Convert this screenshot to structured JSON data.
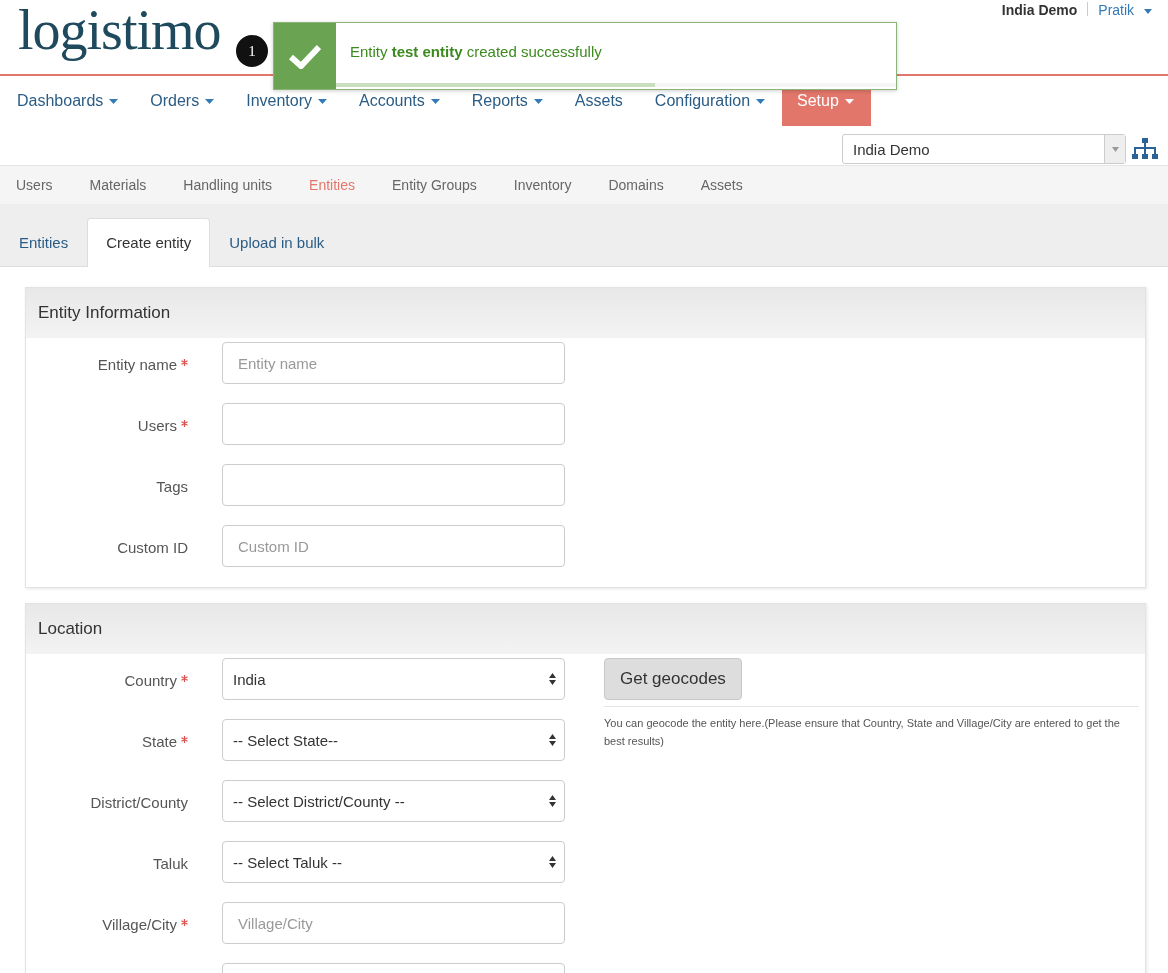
{
  "logo": {
    "text": "logistimo"
  },
  "user_bar": {
    "domain": "India Demo",
    "user": "Pratik"
  },
  "main_nav": [
    {
      "label": "Dashboards",
      "selected": false
    },
    {
      "label": "Orders",
      "selected": false
    },
    {
      "label": "Inventory",
      "selected": false
    },
    {
      "label": "Accounts",
      "selected": false
    },
    {
      "label": "Reports",
      "selected": false
    },
    {
      "label": "Assets",
      "selected": false,
      "dropdown": false
    },
    {
      "label": "Configuration",
      "selected": false
    },
    {
      "label": "Setup",
      "selected": true
    }
  ],
  "toast": {
    "step": "1",
    "message": "Entity **test entity** created successfully",
    "level": 0.57
  },
  "domain_select": {
    "value": "India Demo"
  },
  "sub_nav": [
    {
      "label": "Users",
      "selected": false
    },
    {
      "label": "Materials",
      "selected": false
    },
    {
      "label": "Handling units",
      "selected": false
    },
    {
      "label": "Entities",
      "selected": true
    },
    {
      "label": "Entity Groups",
      "selected": false
    },
    {
      "label": "Inventory",
      "selected": false
    },
    {
      "label": "Domains",
      "selected": false
    },
    {
      "label": "Assets",
      "selected": false
    }
  ],
  "tabs": [
    {
      "label": "Entities",
      "selected": false
    },
    {
      "label": "Create entity",
      "selected": true
    },
    {
      "label": "Upload in bulk",
      "selected": false
    }
  ],
  "panels": [
    {
      "title": "Entity Information",
      "fields": [
        {
          "label": "Entity name",
          "required": true,
          "kind": "input",
          "placeholder": "Entity name"
        },
        {
          "label": "Users",
          "required": true,
          "kind": "input"
        },
        {
          "label": "Tags",
          "required": false,
          "kind": "input"
        },
        {
          "label": "Custom ID",
          "required": false,
          "kind": "input",
          "placeholder": "Custom ID"
        }
      ]
    },
    {
      "title": "Location",
      "fields": [
        {
          "label": "Country",
          "required": true,
          "kind": "select",
          "value": "India"
        },
        {
          "label": "State",
          "required": true,
          "kind": "select",
          "value": "-- Select State--"
        },
        {
          "label": "District/County",
          "required": false,
          "kind": "select",
          "value": "-- Select District/County --"
        },
        {
          "label": "Taluk",
          "required": false,
          "kind": "select",
          "value": "-- Select Taluk --"
        },
        {
          "label": "Village/City",
          "required": true,
          "kind": "input",
          "placeholder": "Village/City"
        },
        {
          "kind": "input"
        }
      ],
      "geocode": {
        "button": "Get geocodes",
        "help": "You can geocode the entity here.(Please ensure that Country, State and Village/City are entered to get the best results)"
      }
    }
  ]
}
